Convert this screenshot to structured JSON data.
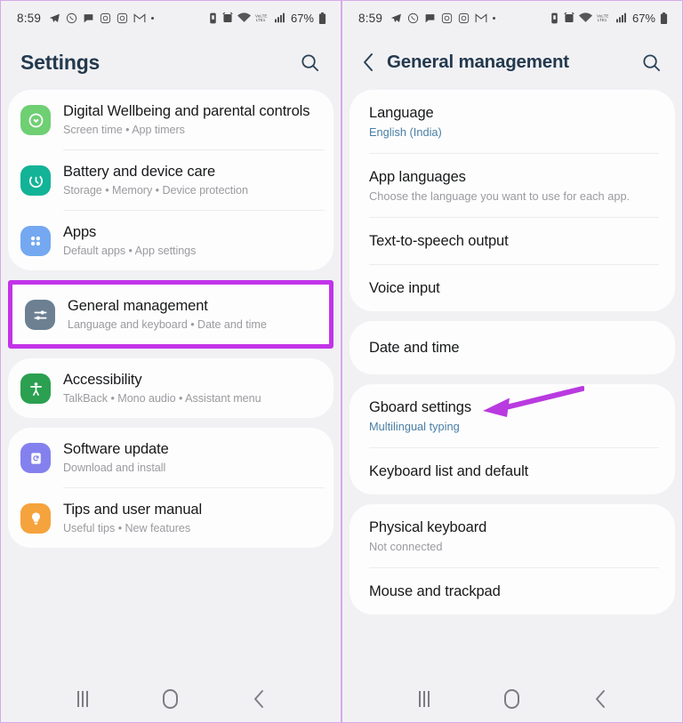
{
  "status_bar": {
    "time": "8:59",
    "left_icons": [
      "telegram-icon",
      "whatsapp-icon",
      "chat-icon",
      "instagram-icon",
      "instagram-alt-icon",
      "gmail-icon",
      "dot-icon"
    ],
    "right_icons": [
      "vibrate-icon",
      "alarm-icon",
      "wifi-icon",
      "volte-icon",
      "signal-icon"
    ],
    "battery_percent": "67%"
  },
  "left_phone": {
    "header": {
      "title": "Settings",
      "search_icon": "search-icon"
    },
    "groups": [
      {
        "rows": [
          {
            "title": "Digital Wellbeing and parental controls",
            "subtitle": "Screen time  •  App timers",
            "icon": "digital-wellbeing-icon",
            "icon_color": "#6fcf73"
          },
          {
            "title": "Battery and device care",
            "subtitle": "Storage  •  Memory  •  Device protection",
            "icon": "battery-care-icon",
            "icon_color": "#12b396"
          },
          {
            "title": "Apps",
            "subtitle": "Default apps  •  App settings",
            "icon": "apps-icon",
            "icon_color": "#74a8f0"
          }
        ]
      },
      {
        "highlighted": true,
        "highlight_color": "#c233e8",
        "rows": [
          {
            "title": "General management",
            "subtitle": "Language and keyboard  •  Date and time",
            "icon": "sliders-icon",
            "icon_color": "#6c8092"
          }
        ]
      },
      {
        "rows": [
          {
            "title": "Accessibility",
            "subtitle": "TalkBack  •  Mono audio  •  Assistant menu",
            "icon": "accessibility-icon",
            "icon_color": "#2aa050"
          }
        ]
      },
      {
        "rows": [
          {
            "title": "Software update",
            "subtitle": "Download and install",
            "icon": "software-update-icon",
            "icon_color": "#8481ee"
          },
          {
            "title": "Tips and user manual",
            "subtitle": "Useful tips  •  New features",
            "icon": "lightbulb-icon",
            "icon_color": "#f5a33c"
          }
        ]
      }
    ]
  },
  "right_phone": {
    "header": {
      "back_icon": "chevron-left-icon",
      "title": "General management",
      "search_icon": "search-icon"
    },
    "annotation": {
      "arrow_icon": "arrow-left-annotation",
      "color": "#b93ae0",
      "points_at": "Date and time"
    },
    "groups": [
      {
        "rows": [
          {
            "title": "Language",
            "subtitle": "English (India)",
            "subtitle_accent": true
          },
          {
            "title": "App languages",
            "subtitle": "Choose the language you want to use for each app."
          },
          {
            "title": "Text-to-speech output",
            "subtitle": ""
          },
          {
            "title": "Voice input",
            "subtitle": ""
          }
        ]
      },
      {
        "rows": [
          {
            "title": "Date and time",
            "subtitle": ""
          }
        ]
      },
      {
        "rows": [
          {
            "title": "Gboard settings",
            "subtitle": "Multilingual typing",
            "subtitle_accent": true
          },
          {
            "title": "Keyboard list and default",
            "subtitle": ""
          }
        ]
      },
      {
        "rows": [
          {
            "title": "Physical keyboard",
            "subtitle": "Not connected"
          },
          {
            "title": "Mouse and trackpad",
            "subtitle": ""
          }
        ]
      }
    ]
  },
  "nav_bar": {
    "recents_label": "recents-button",
    "home_label": "home-button",
    "back_label": "back-button"
  }
}
